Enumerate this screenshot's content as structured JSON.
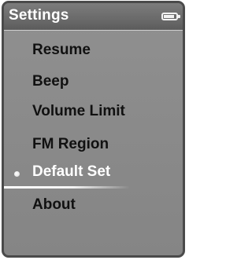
{
  "header": {
    "title": "Settings",
    "battery_icon": "battery-icon"
  },
  "menu": {
    "items": [
      {
        "label": "Resume",
        "selected": false
      },
      {
        "label": "Beep",
        "selected": false
      },
      {
        "label": "Volume Limit",
        "selected": false
      },
      {
        "label": "FM Region",
        "selected": false
      },
      {
        "label": "Default Set",
        "selected": true
      },
      {
        "label": "About",
        "selected": false
      }
    ]
  },
  "colors": {
    "text": "#111111",
    "selected_text": "#ffffff",
    "background": "#8a8a8a",
    "titlebar": "#6a6a6a"
  }
}
